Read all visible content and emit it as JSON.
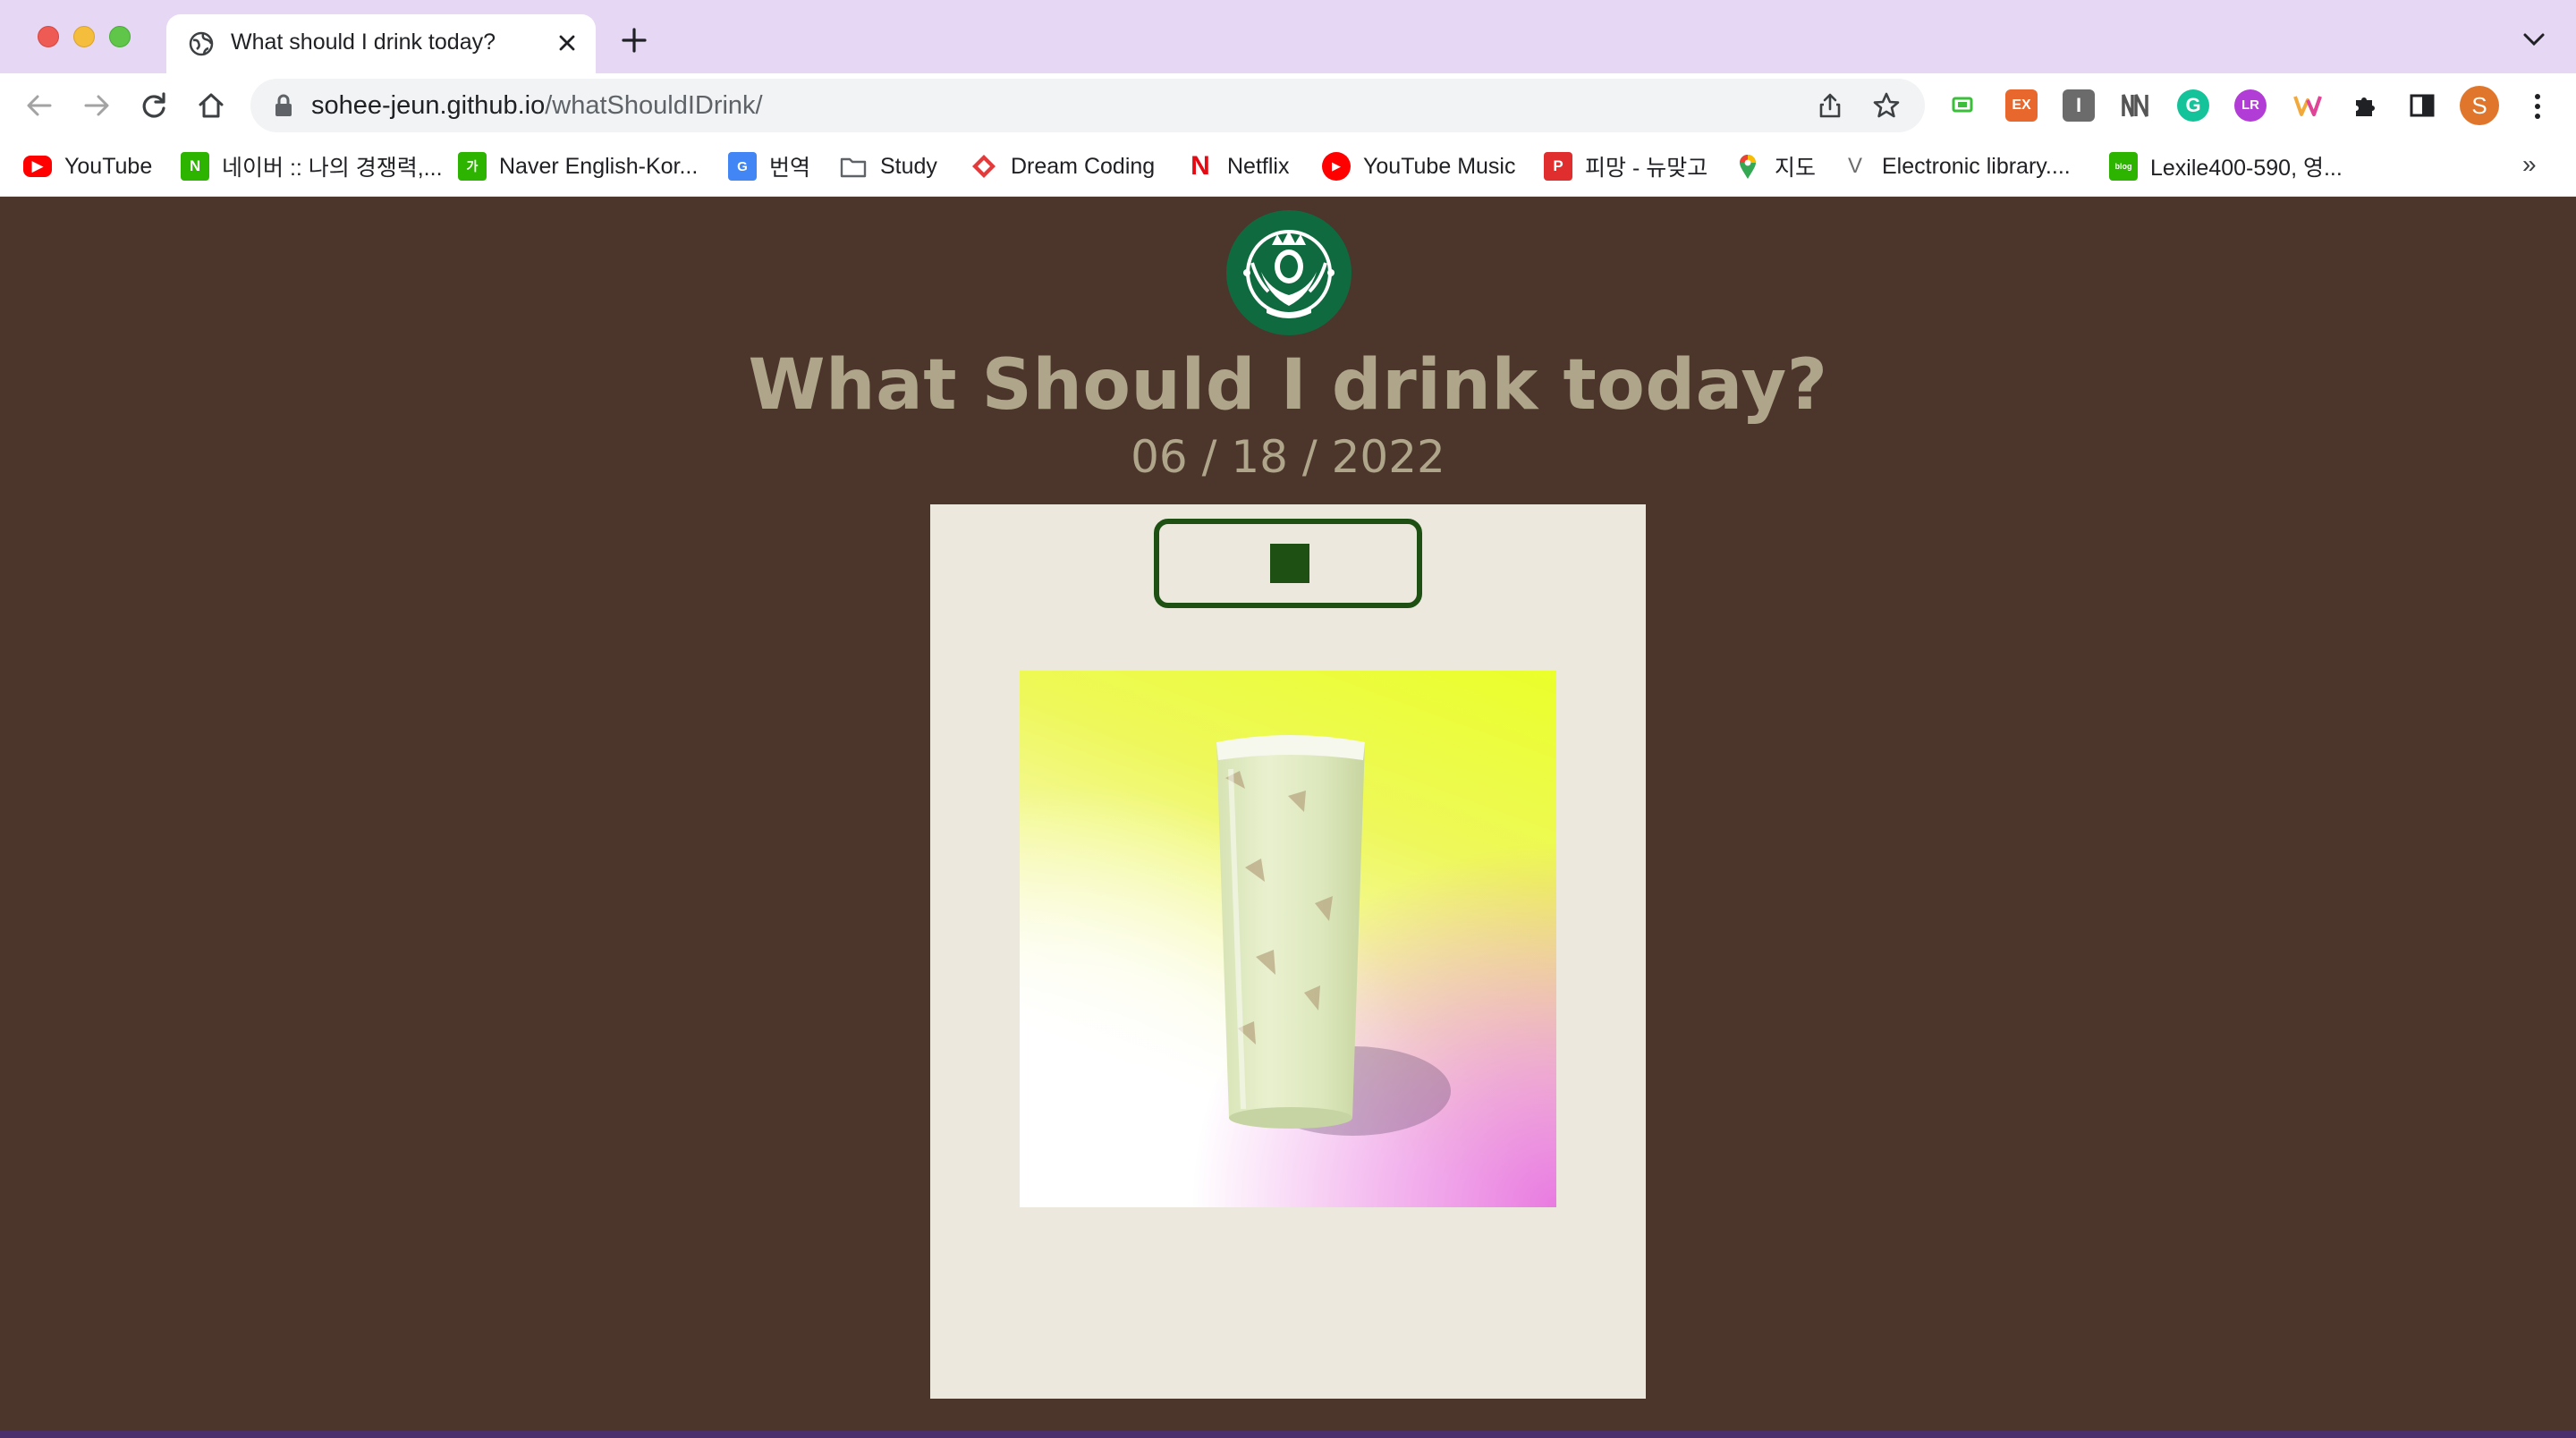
{
  "browser": {
    "tab_title": "What should I drink today?",
    "url_host": "sohee-jeun.github.io",
    "url_path": "/whatShouldIDrink/",
    "profile_initial": "S"
  },
  "bookmarks": [
    {
      "label": "YouTube",
      "icon": "youtube-icon"
    },
    {
      "label": "네이버 :: 나의 경쟁력,...",
      "icon": "naver-icon"
    },
    {
      "label": "Naver English-Kor...",
      "icon": "naver-dict-icon"
    },
    {
      "label": "번역",
      "icon": "google-translate-icon"
    },
    {
      "label": "Study",
      "icon": "folder-icon"
    },
    {
      "label": "Dream Coding",
      "icon": "dream-coding-icon"
    },
    {
      "label": "Netflix",
      "icon": "netflix-icon"
    },
    {
      "label": "YouTube Music",
      "icon": "youtube-music-icon"
    },
    {
      "label": "피망 - 뉴맞고",
      "icon": "pmang-icon"
    },
    {
      "label": "지도",
      "icon": "google-maps-icon"
    },
    {
      "label": "Electronic library....",
      "icon": "electronic-library-icon"
    },
    {
      "label": "Lexile400-590, 영...",
      "icon": "blog-icon"
    }
  ],
  "page": {
    "headline": "What Should I drink today?",
    "date": "06 / 18 / 2022",
    "colors": {
      "background": "#4c362b",
      "text": "#aea58a",
      "card": "#ece8dd",
      "button": "#1e5014"
    }
  }
}
